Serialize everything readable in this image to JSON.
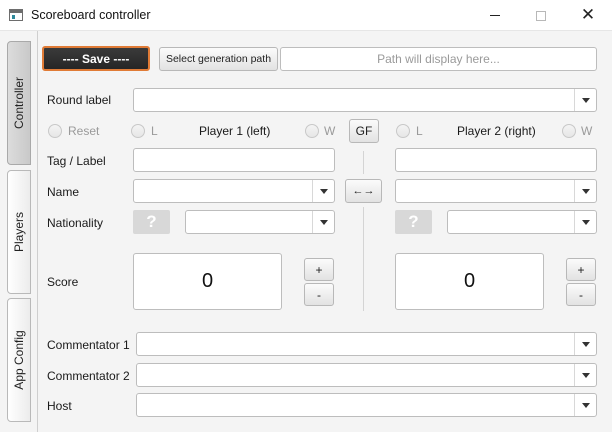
{
  "window": {
    "title": "Scoreboard controller",
    "icons": {
      "app": "app-window-icon",
      "minimize": "minimize-icon",
      "maximize": "maximize-icon",
      "close": "close-icon"
    }
  },
  "sidebar": {
    "tabs": [
      {
        "label": "Controller",
        "active": true
      },
      {
        "label": "Players",
        "active": false
      },
      {
        "label": "App Config",
        "active": false
      }
    ]
  },
  "toolbar": {
    "save_label": "---- Save ----",
    "generation_path_label": "Select generation path",
    "path_placeholder": "Path will display here..."
  },
  "round": {
    "label": "Round label",
    "value": ""
  },
  "controls": {
    "reset_label": "Reset",
    "p1_loser_label": "L",
    "p1_title": "Player 1 (left)",
    "p1_winner_label": "W",
    "gf_label": "GF",
    "p2_loser_label": "L",
    "p2_title": "Player 2 (right)",
    "p2_winner_label": "W"
  },
  "fields": {
    "tag_label": "Tag / Label",
    "name_label": "Name",
    "nationality_label": "Nationality",
    "score_label": "Score",
    "swap_label": "←→"
  },
  "player1": {
    "tag": "",
    "name": "",
    "flag_symbol": "?",
    "nationality": "",
    "score": "0"
  },
  "player2": {
    "tag": "",
    "name": "",
    "flag_symbol": "?",
    "nationality": "",
    "score": "0"
  },
  "stepper": {
    "plus": "+",
    "minus": "-"
  },
  "commentary": {
    "commentator1_label": "Commentator 1",
    "commentator2_label": "Commentator 2",
    "host_label": "Host"
  },
  "colors": {
    "save_bg": "#2f2f2f",
    "save_focus": "#e07b36",
    "flag_placeholder": "#d8d8d8"
  }
}
